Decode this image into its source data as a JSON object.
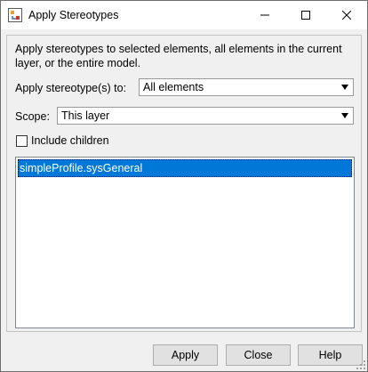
{
  "window": {
    "title": "Apply Stereotypes",
    "controls": [
      "minimize-icon",
      "maximize-icon",
      "close-icon"
    ]
  },
  "description": "Apply stereotypes to selected elements, all elements in the current layer, or the entire model.",
  "apply_to": {
    "label": "Apply stereotype(s) to:",
    "value": "All elements"
  },
  "scope": {
    "label": "Scope:",
    "value": "This layer"
  },
  "include_children": {
    "label": "Include children",
    "checked": false
  },
  "stereotype_list": {
    "items": [
      "simpleProfile.sysGeneral"
    ],
    "selected_index": 0
  },
  "buttons": {
    "apply": "Apply",
    "close": "Close",
    "help": "Help"
  },
  "colors": {
    "selection": "#0078d7",
    "dialog_background": "#f0f0f0"
  }
}
